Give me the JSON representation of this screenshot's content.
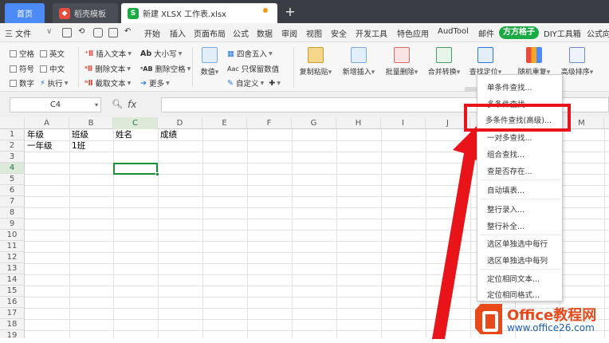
{
  "tabs": {
    "home": "首页",
    "template": "稻壳模板",
    "file": "新建 XLSX 工作表.xlsx",
    "add": "+"
  },
  "menu": {
    "file": "三 文件",
    "items": [
      "开始",
      "插入",
      "页面布局",
      "公式",
      "数据",
      "审阅",
      "视图",
      "安全",
      "开发工具",
      "特色应用",
      "AudTool",
      "邮件"
    ],
    "ffbx": "方方格子",
    "diy": "DIY工具箱",
    "formula_cut": "公式向"
  },
  "ribbon": {
    "checks": [
      "空格",
      "符号",
      "数字",
      "英文",
      "中文"
    ],
    "exec": "执行",
    "insert_text": "插入文本",
    "delete_text": "删除文本",
    "cut_text": "截取文本",
    "case": "大小写",
    "del_space": "删除空格",
    "more": "更多",
    "numeric": "数值",
    "round": "四舍五入",
    "keep_value": "只保留数值",
    "custom": "自定义",
    "big": [
      "复制粘贴",
      "新增插入",
      "批量删除",
      "合并转换",
      "查找定位",
      "随机重复",
      "高级排序"
    ]
  },
  "formula_bar": {
    "cell_ref": "C4",
    "fx": "fx",
    "value": ""
  },
  "columns": [
    "A",
    "B",
    "C",
    "D",
    "E",
    "F",
    "G",
    "H",
    "I",
    "J",
    "K",
    "L",
    "M"
  ],
  "rows": [
    "1",
    "2",
    "3",
    "4",
    "5",
    "6",
    "7",
    "8",
    "9",
    "10",
    "11",
    "12",
    "13",
    "14",
    "15",
    "16",
    "17",
    "18",
    "19"
  ],
  "cells": {
    "A1": "年级",
    "B1": "班级",
    "C1": "姓名",
    "D1": "成绩",
    "A2": "一年级",
    "B2": "1班"
  },
  "dropdown": {
    "items": [
      "单条件查找...",
      "多条件查找...",
      "多条件查找(高级)...",
      "一对多查找...",
      "组合查找...",
      "查是否存在...",
      "自动填表...",
      "整行录入...",
      "整行补全...",
      "选区单独选中每行",
      "选区单独选中每列",
      "定位相同文本...",
      "定位相同格式..."
    ]
  },
  "watermark": {
    "brand": "Office教程网",
    "url": "www.office26.com"
  },
  "colors": {
    "accent": "#1aab45",
    "highlight": "#e8141a",
    "tabbar": "#3a3d44"
  }
}
